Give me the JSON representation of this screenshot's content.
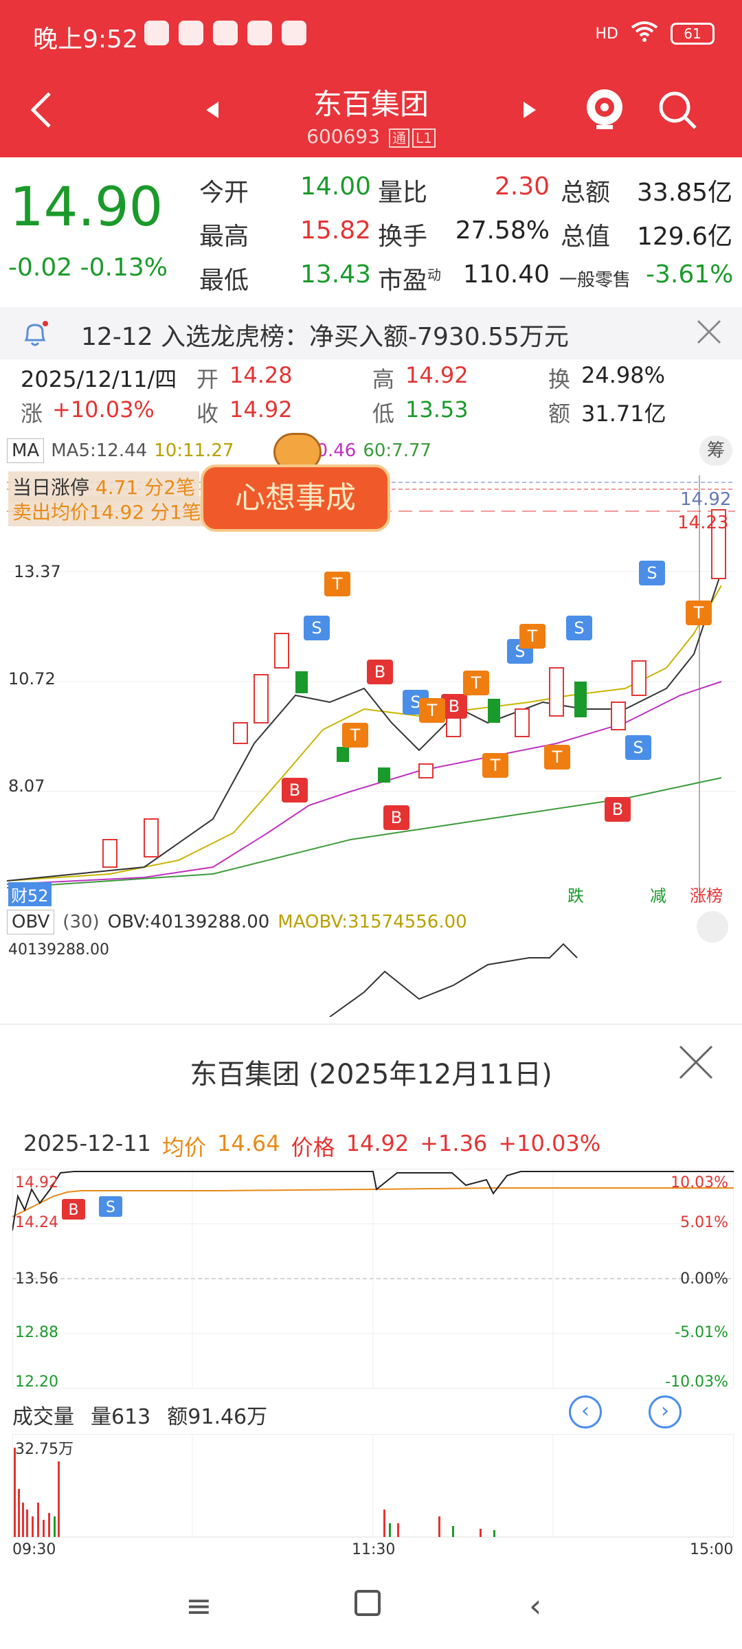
{
  "status_bar": {
    "time": "晚上9:52",
    "battery": "61",
    "signal": "HD"
  },
  "header": {
    "title": "东百集团",
    "code": "600693",
    "tag": "通",
    "level": "L1"
  },
  "quote": {
    "price": "14.90",
    "change": "-0.02",
    "change_pct": "-0.13%",
    "rows": [
      {
        "l1": "今开",
        "v1": "14.00",
        "l2": "量比",
        "v2": "2.30",
        "l3": "总额",
        "v3": "33.85亿"
      },
      {
        "l1": "最高",
        "v1": "15.82",
        "l2": "换手",
        "v2": "27.58%",
        "l3": "总值",
        "v3": "129.6亿"
      },
      {
        "l1": "最低",
        "v1": "13.43",
        "l2": "市盈",
        "l2_sup": "动",
        "v2": "110.40",
        "l3": "一般零售",
        "v3": "-3.61%"
      }
    ]
  },
  "notice": {
    "text": "12-12 入选龙虎榜：净买入额-7930.55万元"
  },
  "day_info": {
    "date": "2025/12/11/四",
    "open_label": "开",
    "open": "14.28",
    "high_label": "高",
    "high": "14.92",
    "turnover_label": "换",
    "turnover": "24.98%",
    "rise_label": "涨",
    "rise": "+10.03%",
    "close_label": "收",
    "close": "14.92",
    "low_label": "低",
    "low": "13.53",
    "amount_label": "额",
    "amount": "31.71亿"
  },
  "ma_row": {
    "button": "MA",
    "ma5": "MA5:12.44",
    "ma10": "10:11.27",
    "ma20": "0.46",
    "ma60": "60:7.77",
    "chou": "筹"
  },
  "overlay": {
    "limit_up": "当日涨停",
    "limit_up_val": "4.71 分2笔",
    "sell_avg": "卖出均价14.92 分1笔",
    "sticker": "心想事成"
  },
  "kline_axis": {
    "top_right_1": "14.92",
    "top_right_2": "14.23",
    "y1": "13.37",
    "y2": "10.72",
    "y3": "8.07",
    "badge_cai": "财52",
    "badge_die": "跌",
    "badge_jian": "减",
    "badge_zhang": "涨榜"
  },
  "obv_row": {
    "button": "OBV",
    "param": "(30)",
    "obv": "OBV:40139288.00",
    "maobv": "MAOBV:31574556.00",
    "axis": "40139288.00"
  },
  "popup": {
    "title": "东百集团 (2025年12月11日)",
    "date": "2025-12-11",
    "avg_label": "均价",
    "avg": "14.64",
    "price_label": "价格",
    "price": "14.92",
    "chg": "+1.36",
    "chg_pct": "+10.03%",
    "y_left": [
      "14.92",
      "14.24",
      "13.56",
      "12.88",
      "12.20"
    ],
    "y_right": [
      "10.03%",
      "5.01%",
      "0.00%",
      "-5.01%",
      "-10.03%"
    ],
    "vol_label": "成交量",
    "vol": "量613",
    "amt": "额91.46万",
    "vol_axis": "32.75万",
    "time_axis": [
      "09:30",
      "11:30",
      "15:00"
    ]
  },
  "colors": {
    "brand_red": "#e8343a",
    "up": "#e53333",
    "down": "#1a9a2a",
    "accent": "#e88a16"
  }
}
